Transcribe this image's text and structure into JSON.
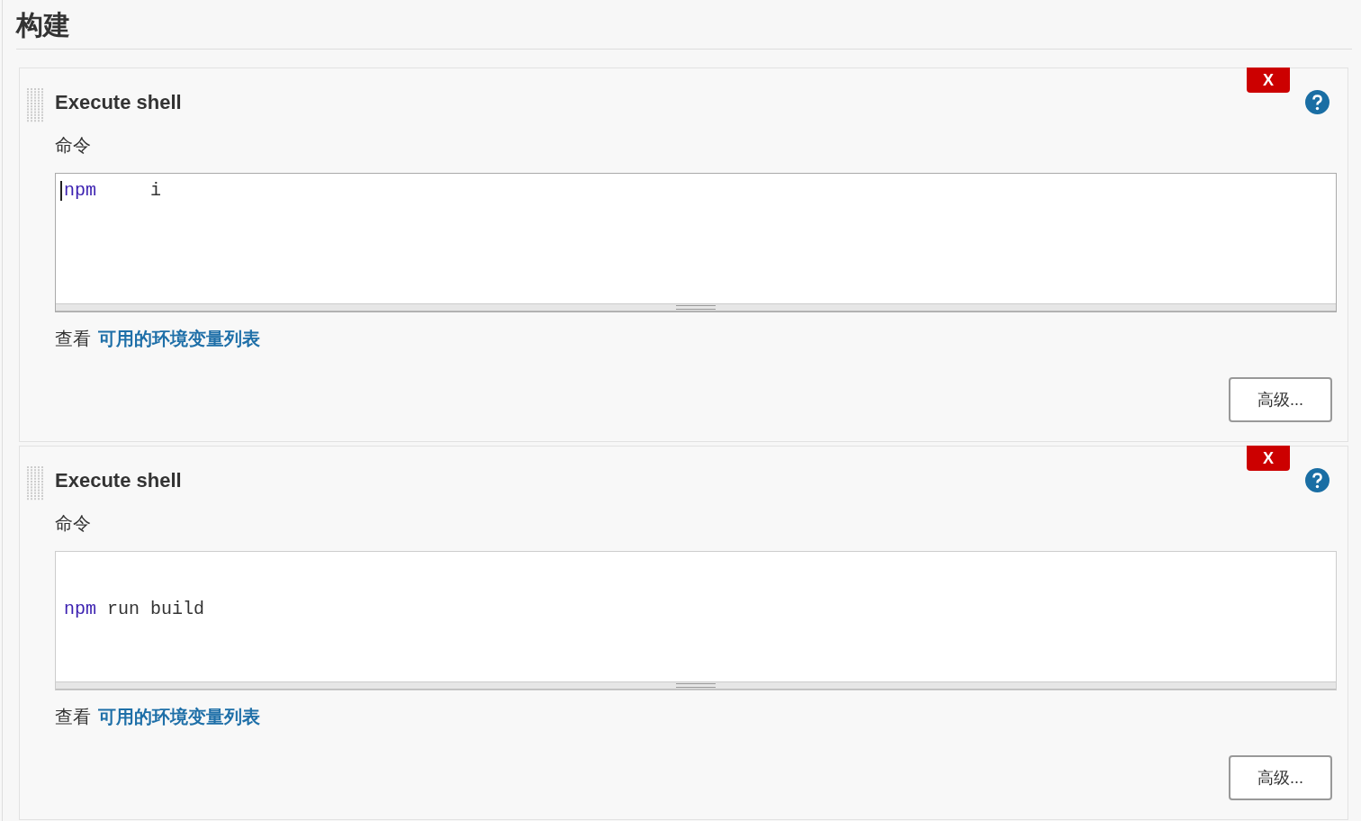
{
  "section": {
    "title": "构建"
  },
  "steps": [
    {
      "title": "Execute shell",
      "delete_label": "X",
      "field_label": "命令",
      "editor": {
        "focused": true,
        "lines": [
          {
            "kind": "code",
            "tokens": [
              {
                "kind": "keyword",
                "text": "npm"
              },
              {
                "kind": "plain",
                "text": "     i"
              }
            ]
          }
        ]
      },
      "hint": "查看",
      "link": "可用的环境变量列表",
      "advanced_button": "高级..."
    },
    {
      "title": "Execute shell",
      "delete_label": "X",
      "field_label": "命令",
      "editor": {
        "focused": false,
        "lines": [
          {
            "kind": "blank"
          },
          {
            "kind": "blank"
          },
          {
            "kind": "code",
            "tokens": [
              {
                "kind": "keyword",
                "text": "npm"
              },
              {
                "kind": "plain",
                "text": " run build"
              }
            ]
          }
        ]
      },
      "hint": "查看",
      "link": "可用的环境变量列表",
      "advanced_button": "高级..."
    }
  ]
}
